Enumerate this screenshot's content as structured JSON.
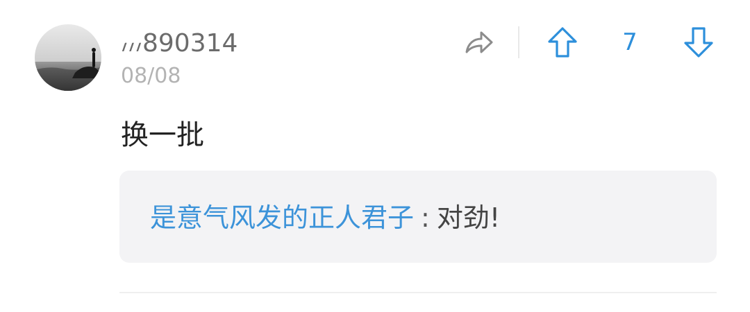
{
  "comment": {
    "username": "៸៸៸890314",
    "date": "08/08",
    "text": "换一批",
    "vote_count": "7"
  },
  "reply": {
    "author": "是意气风发的正人君子",
    "separator": ":",
    "content": "对劲!"
  },
  "icons": {
    "share": "share-arrow-icon",
    "upvote": "upvote-arrow-icon",
    "downvote": "downvote-arrow-icon"
  },
  "colors": {
    "accent": "#2d8fdb",
    "username": "#6b6b6b",
    "date": "#b3b3b3",
    "reply_bg": "#f3f3f5"
  }
}
